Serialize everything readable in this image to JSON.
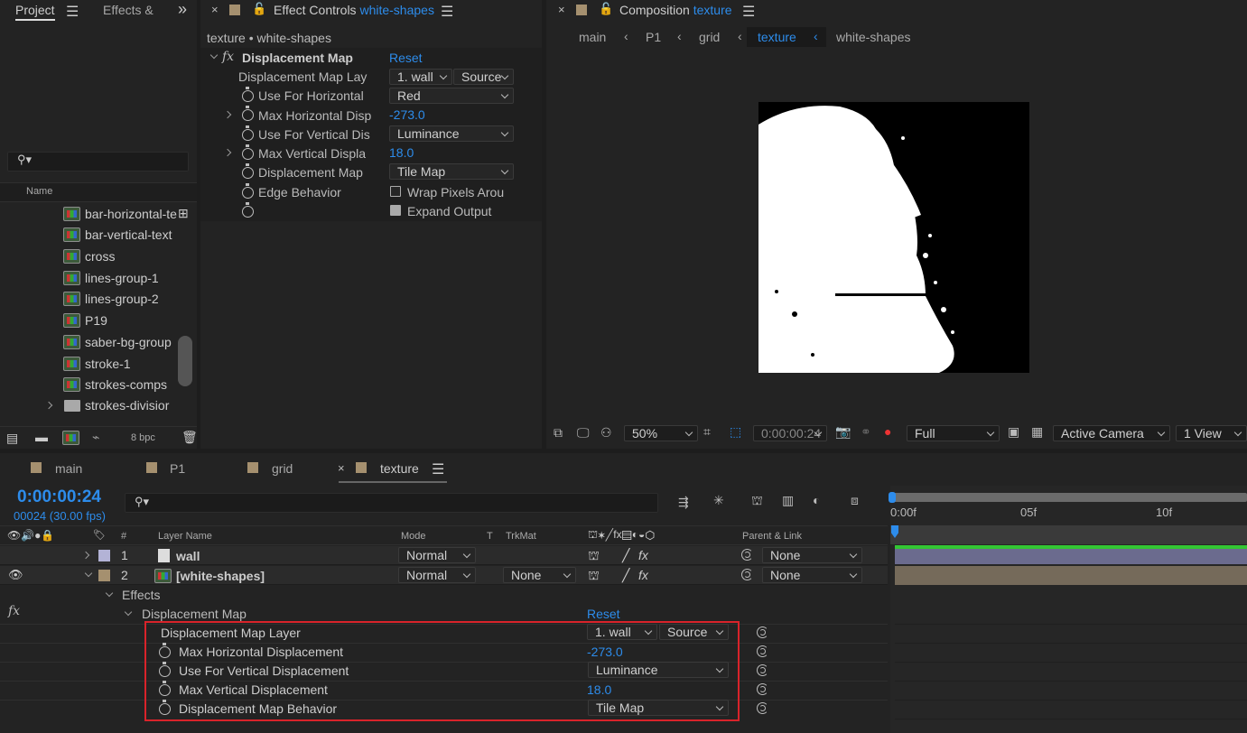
{
  "project": {
    "tabs": [
      "Project",
      "Effects &"
    ],
    "search_placeholder": "",
    "column_name": "Name",
    "items": [
      {
        "label": "bar-horizontal-te"
      },
      {
        "label": "bar-vertical-text"
      },
      {
        "label": "cross"
      },
      {
        "label": "lines-group-1"
      },
      {
        "label": "lines-group-2"
      },
      {
        "label": "P19"
      },
      {
        "label": "saber-bg-group"
      },
      {
        "label": "stroke-1"
      },
      {
        "label": "strokes-comps"
      },
      {
        "label": "strokes-divisior"
      }
    ],
    "bpc": "8 bpc"
  },
  "effect_controls": {
    "tab_title": "Effect Controls",
    "tab_layer": "white-shapes",
    "breadcrumb": "texture • white-shapes",
    "effect_name": "Displacement Map",
    "reset": "Reset",
    "rows": {
      "map_layer": "Displacement Map Lay",
      "use_h": "Use For Horizontal",
      "max_h": "Max Horizontal Disp",
      "use_v": "Use For Vertical Dis",
      "max_v": "Max Vertical Displa",
      "behavior": "Displacement Map",
      "edge": "Edge Behavior"
    },
    "values": {
      "map_layer": "1. wall",
      "map_source": "Source",
      "use_h": "Red",
      "max_h": "-273.0",
      "use_v": "Luminance",
      "max_v": "18.0",
      "behavior": "Tile Map",
      "wrap": "Wrap Pixels Arou",
      "expand": "Expand Output"
    }
  },
  "composition": {
    "tab_title": "Composition",
    "tab_name": "texture",
    "breadcrumbs": [
      "main",
      "P1",
      "grid",
      "texture",
      "white-shapes"
    ],
    "zoom": "50%",
    "timecode": "0:00:00:24",
    "resolution": "Full",
    "camera": "Active Camera",
    "views": "1 View"
  },
  "timeline": {
    "tabs": [
      "main",
      "P1",
      "grid",
      "texture"
    ],
    "timecode": "0:00:00:24",
    "frames": "00024 (30.00 fps)",
    "headers": {
      "num": "#",
      "layer_name": "Layer Name",
      "mode": "Mode",
      "t": "T",
      "trkmat": "TrkMat",
      "parent": "Parent & Link"
    },
    "layers": [
      {
        "num": "1",
        "name": "wall",
        "mode": "Normal",
        "trkmat": "",
        "parent": "None"
      },
      {
        "num": "2",
        "name": "[white-shapes]",
        "mode": "Normal",
        "trkmat": "None",
        "parent": "None"
      }
    ],
    "effects_label": "Effects",
    "effect_name": "Displacement Map",
    "reset": "Reset",
    "props": [
      {
        "name": "Displacement Map Layer",
        "value": "1. wall",
        "extra": "Source"
      },
      {
        "name": "Max Horizontal Displacement",
        "value": "-273.0"
      },
      {
        "name": "Use For Vertical Displacement",
        "value": "Luminance"
      },
      {
        "name": "Max Vertical Displacement",
        "value": "18.0"
      },
      {
        "name": "Displacement Map Behavior",
        "value": "Tile Map"
      }
    ],
    "ruler": [
      "0:00f",
      "05f",
      "10f"
    ]
  },
  "colors": {
    "accent": "#2d8ceb",
    "highlight_box": "#d9232a",
    "green_bar": "#33c633"
  }
}
